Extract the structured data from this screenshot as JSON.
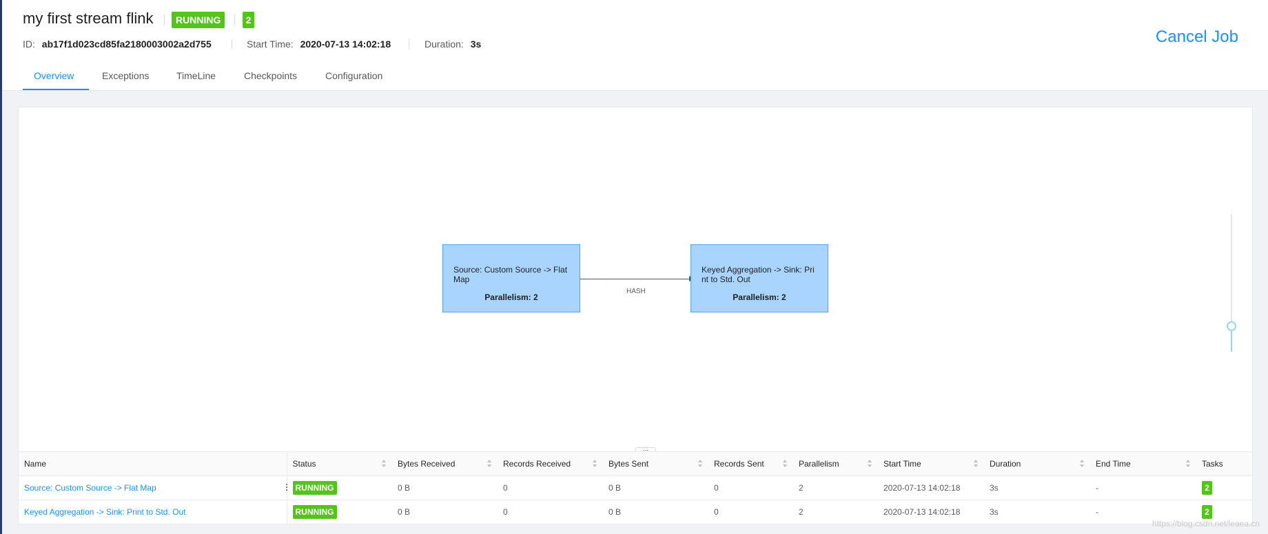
{
  "job": {
    "name": "my first stream flink",
    "status": "RUNNING",
    "task_count": "2",
    "id_label": "ID:",
    "id": "ab17f1d023cd85fa2180003002a2d755",
    "start_label": "Start Time:",
    "start_time": "2020-07-13 14:02:18",
    "duration_label": "Duration:",
    "duration": "3s",
    "cancel_label": "Cancel Job"
  },
  "tabs": [
    "Overview",
    "Exceptions",
    "TimeLine",
    "Checkpoints",
    "Configuration"
  ],
  "graph": {
    "nodes": [
      {
        "name": "Source: Custom Source -> Flat Map",
        "parallelism": "Parallelism: 2"
      },
      {
        "name": "Keyed Aggregation -> Sink: Print to Std. Out",
        "parallelism": "Parallelism: 2"
      }
    ],
    "edge_label": "HASH",
    "resize_label": "..."
  },
  "table": {
    "headers": [
      "Name",
      "Status",
      "Bytes Received",
      "Records Received",
      "Bytes Sent",
      "Records Sent",
      "Parallelism",
      "Start Time",
      "Duration",
      "End Time",
      "Tasks"
    ],
    "rows": [
      {
        "name": "Source: Custom Source -> Flat Map",
        "status": "RUNNING",
        "bytes_received": "0 B",
        "records_received": "0",
        "bytes_sent": "0 B",
        "records_sent": "0",
        "parallelism": "2",
        "start_time": "2020-07-13 14:02:18",
        "duration": "3s",
        "end_time": "-",
        "tasks": "2"
      },
      {
        "name": "Keyed Aggregation -> Sink: Print to Std. Out",
        "status": "RUNNING",
        "bytes_received": "0 B",
        "records_received": "0",
        "bytes_sent": "0 B",
        "records_sent": "0",
        "parallelism": "2",
        "start_time": "2020-07-13 14:02:18",
        "duration": "3s",
        "end_time": "-",
        "tasks": "2"
      }
    ]
  },
  "colors": {
    "accent": "#1890ff",
    "running": "#52c41a",
    "node_fill": "#a9d4fd"
  },
  "watermark": "https://blog.csdn.net/leaea.cn"
}
